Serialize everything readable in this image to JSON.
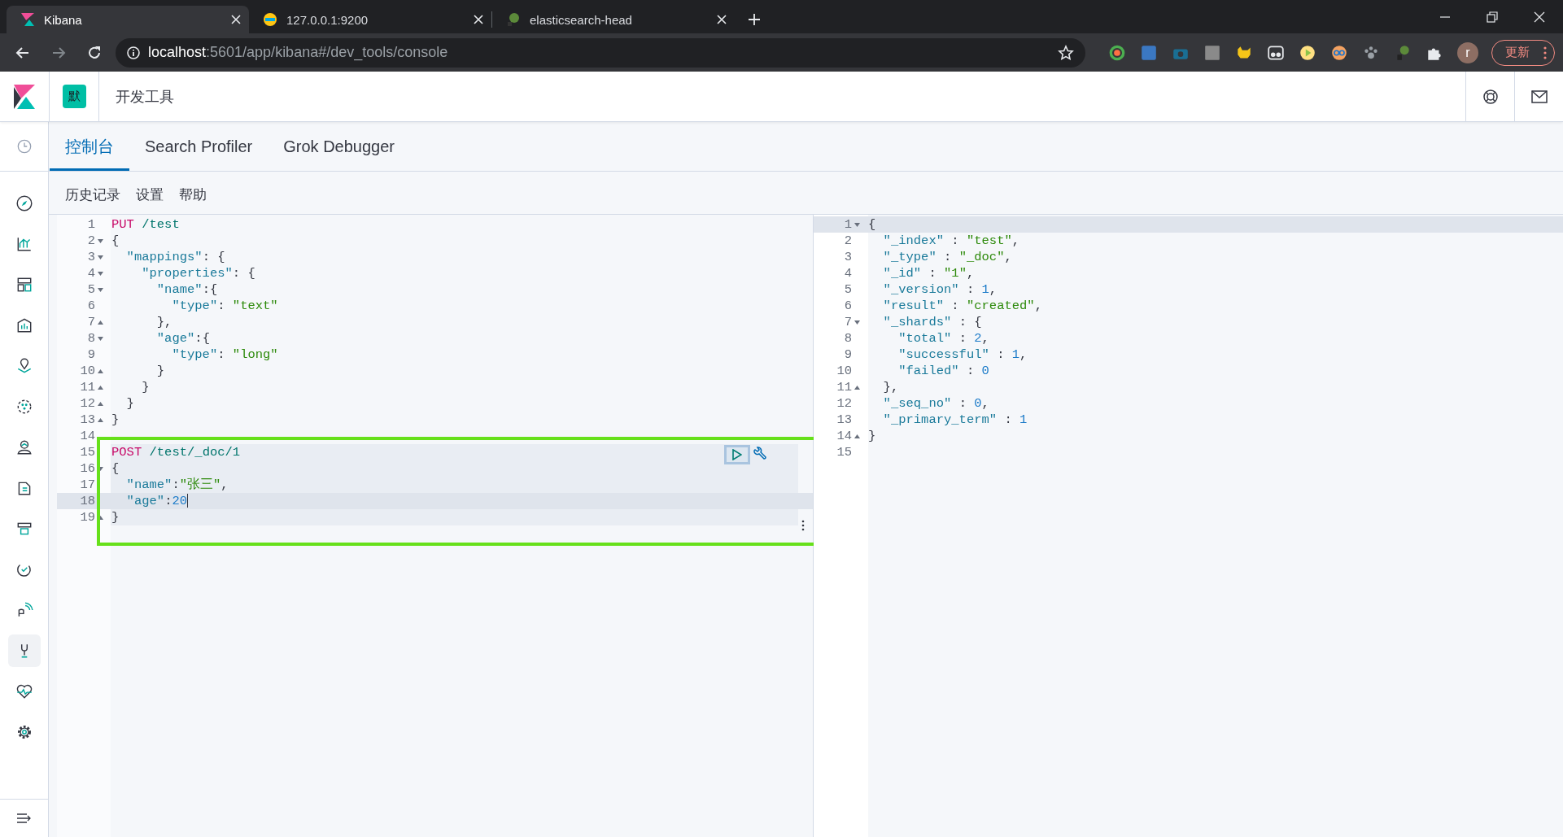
{
  "browser": {
    "tabs": [
      {
        "title": "Kibana",
        "selected": true
      },
      {
        "title": "127.0.0.1:9200",
        "selected": false
      },
      {
        "title": "elasticsearch-head",
        "selected": false
      }
    ],
    "url": {
      "host": "localhost",
      "path": ":5601/app/kibana#/dev_tools/console"
    },
    "profile_initial": "r",
    "update_button": "更新"
  },
  "header": {
    "space_avatar": "默",
    "breadcrumb": "开发工具"
  },
  "nav_items": [
    {
      "kind": "clock",
      "selected": false
    },
    {
      "kind": "compass",
      "selected": false
    },
    {
      "kind": "chart",
      "selected": false
    },
    {
      "kind": "layout",
      "selected": false
    },
    {
      "kind": "canvas",
      "selected": false
    },
    {
      "kind": "map",
      "selected": false
    },
    {
      "kind": "ml",
      "selected": false
    },
    {
      "kind": "user",
      "selected": false
    },
    {
      "kind": "logs",
      "selected": false
    },
    {
      "kind": "stack",
      "selected": false
    },
    {
      "kind": "uptime",
      "selected": false
    },
    {
      "kind": "signal",
      "selected": false
    },
    {
      "kind": "wrench",
      "selected": true
    },
    {
      "kind": "heart",
      "selected": false
    },
    {
      "kind": "gear",
      "selected": false
    }
  ],
  "tabs": [
    {
      "label": "控制台",
      "selected": true
    },
    {
      "label": "Search Profiler",
      "selected": false
    },
    {
      "label": "Grok Debugger",
      "selected": false
    }
  ],
  "toolbar": [
    "历史记录",
    "设置",
    "帮助"
  ],
  "editors": [
    {
      "kind": "input",
      "focused": true,
      "annotation": {
        "kind": "frame"
      },
      "lines": [
        {
          "number": "1",
          "fold_start": false,
          "fold_end": false,
          "request": false,
          "cursor": false,
          "tokens": [
            {
              "kind": "method",
              "text": "PUT"
            },
            {
              "kind": "path",
              "text": " /test"
            }
          ]
        },
        {
          "number": "2",
          "fold_start": true,
          "fold_end": false,
          "request": false,
          "cursor": false,
          "tokens": [
            {
              "kind": "punct",
              "text": "{"
            }
          ]
        },
        {
          "number": "3",
          "fold_start": true,
          "fold_end": false,
          "request": false,
          "cursor": false,
          "tokens": [
            {
              "kind": "key",
              "text": "  \"mappings\""
            },
            {
              "kind": "punct",
              "text": ": {"
            }
          ]
        },
        {
          "number": "4",
          "fold_start": true,
          "fold_end": false,
          "request": false,
          "cursor": false,
          "tokens": [
            {
              "kind": "key",
              "text": "    \"properties\""
            },
            {
              "kind": "punct",
              "text": ": {"
            }
          ]
        },
        {
          "number": "5",
          "fold_start": true,
          "fold_end": false,
          "request": false,
          "cursor": false,
          "tokens": [
            {
              "kind": "key",
              "text": "      \"name\""
            },
            {
              "kind": "punct",
              "text": ":{"
            }
          ]
        },
        {
          "number": "6",
          "fold_start": false,
          "fold_end": false,
          "request": false,
          "cursor": false,
          "tokens": [
            {
              "kind": "key",
              "text": "        \"type\""
            },
            {
              "kind": "punct",
              "text": ": "
            },
            {
              "kind": "string",
              "text": "\"text\""
            }
          ]
        },
        {
          "number": "7",
          "fold_start": false,
          "fold_end": true,
          "request": false,
          "cursor": false,
          "tokens": [
            {
              "kind": "punct",
              "text": "      },"
            }
          ]
        },
        {
          "number": "8",
          "fold_start": true,
          "fold_end": false,
          "request": false,
          "cursor": false,
          "tokens": [
            {
              "kind": "key",
              "text": "      \"age\""
            },
            {
              "kind": "punct",
              "text": ":{"
            }
          ]
        },
        {
          "number": "9",
          "fold_start": false,
          "fold_end": false,
          "request": false,
          "cursor": false,
          "tokens": [
            {
              "kind": "key",
              "text": "        \"type\""
            },
            {
              "kind": "punct",
              "text": ": "
            },
            {
              "kind": "string",
              "text": "\"long\""
            }
          ]
        },
        {
          "number": "10",
          "fold_start": false,
          "fold_end": true,
          "request": false,
          "cursor": false,
          "tokens": [
            {
              "kind": "punct",
              "text": "      }"
            }
          ]
        },
        {
          "number": "11",
          "fold_start": false,
          "fold_end": true,
          "request": false,
          "cursor": false,
          "tokens": [
            {
              "kind": "punct",
              "text": "    }"
            }
          ]
        },
        {
          "number": "12",
          "fold_start": false,
          "fold_end": true,
          "request": false,
          "cursor": false,
          "tokens": [
            {
              "kind": "punct",
              "text": "  }"
            }
          ]
        },
        {
          "number": "13",
          "fold_start": false,
          "fold_end": true,
          "request": false,
          "cursor": false,
          "tokens": [
            {
              "kind": "punct",
              "text": "}"
            }
          ]
        },
        {
          "number": "14",
          "fold_start": false,
          "fold_end": false,
          "request": false,
          "cursor": false
        },
        {
          "number": "15",
          "fold_start": false,
          "fold_end": false,
          "request": true,
          "cursor": false,
          "tokens": [
            {
              "kind": "method",
              "text": "POST"
            },
            {
              "kind": "path",
              "text": " /test/_doc/1"
            }
          ]
        },
        {
          "number": "16",
          "fold_start": true,
          "fold_end": false,
          "request": true,
          "cursor": false,
          "tokens": [
            {
              "kind": "punct",
              "text": "{"
            }
          ]
        },
        {
          "number": "17",
          "fold_start": false,
          "fold_end": false,
          "request": true,
          "cursor": false,
          "tokens": [
            {
              "kind": "key",
              "text": "  \"name\""
            },
            {
              "kind": "punct",
              "text": ":"
            },
            {
              "kind": "string",
              "text": "\"张三\""
            },
            {
              "kind": "punct",
              "text": ","
            }
          ]
        },
        {
          "number": "18",
          "fold_start": false,
          "fold_end": false,
          "request": true,
          "cursor": true,
          "tokens": [
            {
              "kind": "key",
              "text": "  \"age\""
            },
            {
              "kind": "punct",
              "text": ":"
            },
            {
              "kind": "number",
              "text": "20"
            }
          ]
        },
        {
          "number": "19",
          "fold_start": false,
          "fold_end": true,
          "request": true,
          "cursor": false,
          "tokens": [
            {
              "kind": "punct",
              "text": "}"
            }
          ]
        }
      ]
    },
    {
      "kind": "output",
      "focused": false,
      "lines": [
        {
          "number": "1",
          "fold_start": true,
          "fold_end": false,
          "request": false,
          "cursor": true,
          "tokens": [
            {
              "kind": "punct",
              "text": "{"
            }
          ]
        },
        {
          "number": "2",
          "fold_start": false,
          "fold_end": false,
          "request": false,
          "cursor": false,
          "tokens": [
            {
              "kind": "key",
              "text": "  \"_index\""
            },
            {
              "kind": "punct",
              "text": " : "
            },
            {
              "kind": "string",
              "text": "\"test\""
            },
            {
              "kind": "punct",
              "text": ","
            }
          ]
        },
        {
          "number": "3",
          "fold_start": false,
          "fold_end": false,
          "request": false,
          "cursor": false,
          "tokens": [
            {
              "kind": "key",
              "text": "  \"_type\""
            },
            {
              "kind": "punct",
              "text": " : "
            },
            {
              "kind": "string",
              "text": "\"_doc\""
            },
            {
              "kind": "punct",
              "text": ","
            }
          ]
        },
        {
          "number": "4",
          "fold_start": false,
          "fold_end": false,
          "request": false,
          "cursor": false,
          "tokens": [
            {
              "kind": "key",
              "text": "  \"_id\""
            },
            {
              "kind": "punct",
              "text": " : "
            },
            {
              "kind": "string",
              "text": "\"1\""
            },
            {
              "kind": "punct",
              "text": ","
            }
          ]
        },
        {
          "number": "5",
          "fold_start": false,
          "fold_end": false,
          "request": false,
          "cursor": false,
          "tokens": [
            {
              "kind": "key",
              "text": "  \"_version\""
            },
            {
              "kind": "punct",
              "text": " : "
            },
            {
              "kind": "number",
              "text": "1"
            },
            {
              "kind": "punct",
              "text": ","
            }
          ]
        },
        {
          "number": "6",
          "fold_start": false,
          "fold_end": false,
          "request": false,
          "cursor": false,
          "tokens": [
            {
              "kind": "key",
              "text": "  \"result\""
            },
            {
              "kind": "punct",
              "text": " : "
            },
            {
              "kind": "string",
              "text": "\"created\""
            },
            {
              "kind": "punct",
              "text": ","
            }
          ]
        },
        {
          "number": "7",
          "fold_start": true,
          "fold_end": false,
          "request": false,
          "cursor": false,
          "tokens": [
            {
              "kind": "key",
              "text": "  \"_shards\""
            },
            {
              "kind": "punct",
              "text": " : {"
            }
          ]
        },
        {
          "number": "8",
          "fold_start": false,
          "fold_end": false,
          "request": false,
          "cursor": false,
          "tokens": [
            {
              "kind": "key",
              "text": "    \"total\""
            },
            {
              "kind": "punct",
              "text": " : "
            },
            {
              "kind": "number",
              "text": "2"
            },
            {
              "kind": "punct",
              "text": ","
            }
          ]
        },
        {
          "number": "9",
          "fold_start": false,
          "fold_end": false,
          "request": false,
          "cursor": false,
          "tokens": [
            {
              "kind": "key",
              "text": "    \"successful\""
            },
            {
              "kind": "punct",
              "text": " : "
            },
            {
              "kind": "number",
              "text": "1"
            },
            {
              "kind": "punct",
              "text": ","
            }
          ]
        },
        {
          "number": "10",
          "fold_start": false,
          "fold_end": false,
          "request": false,
          "cursor": false,
          "tokens": [
            {
              "kind": "key",
              "text": "    \"failed\""
            },
            {
              "kind": "punct",
              "text": " : "
            },
            {
              "kind": "number",
              "text": "0"
            }
          ]
        },
        {
          "number": "11",
          "fold_start": false,
          "fold_end": true,
          "request": false,
          "cursor": false,
          "tokens": [
            {
              "kind": "punct",
              "text": "  },"
            }
          ]
        },
        {
          "number": "12",
          "fold_start": false,
          "fold_end": false,
          "request": false,
          "cursor": false,
          "tokens": [
            {
              "kind": "key",
              "text": "  \"_seq_no\""
            },
            {
              "kind": "punct",
              "text": " : "
            },
            {
              "kind": "number",
              "text": "0"
            },
            {
              "kind": "punct",
              "text": ","
            }
          ]
        },
        {
          "number": "13",
          "fold_start": false,
          "fold_end": false,
          "request": false,
          "cursor": false,
          "tokens": [
            {
              "kind": "key",
              "text": "  \"_primary_term\""
            },
            {
              "kind": "punct",
              "text": " : "
            },
            {
              "kind": "number",
              "text": "1"
            }
          ]
        },
        {
          "number": "14",
          "fold_start": false,
          "fold_end": true,
          "request": false,
          "cursor": false,
          "tokens": [
            {
              "kind": "punct",
              "text": "}"
            }
          ]
        },
        {
          "number": "15",
          "fold_start": false,
          "fold_end": false,
          "request": false,
          "cursor": false
        }
      ]
    }
  ]
}
